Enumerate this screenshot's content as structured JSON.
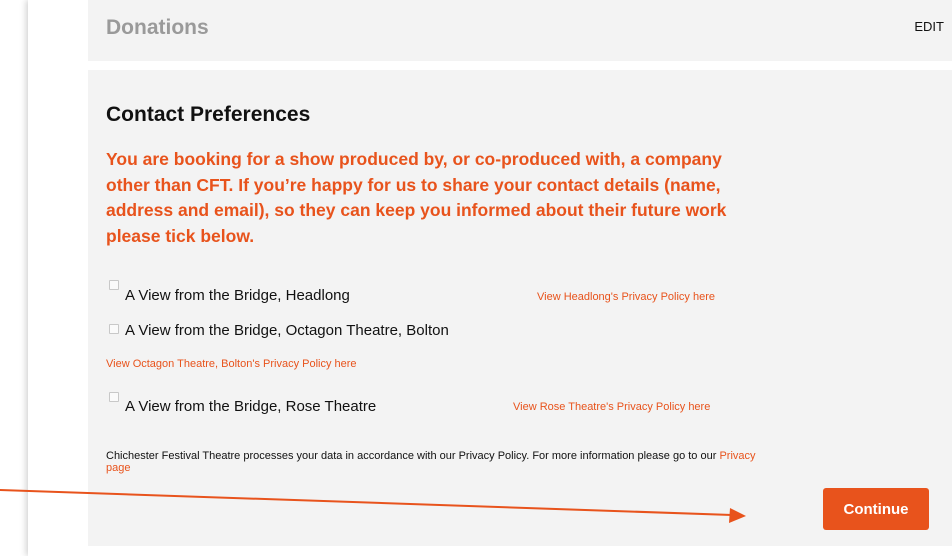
{
  "donations": {
    "title": "Donations",
    "edit_label": "EDIT"
  },
  "contact": {
    "title": "Contact Preferences",
    "notice": "You are booking for a show produced by, or co-produced with, a company other than CFT. If you’re happy for us to share your contact details (name, address and email), so they can keep you informed about their future work please tick below.",
    "options": [
      {
        "label": "A View from the Bridge, Headlong",
        "policy_link": "View Headlong's Privacy Policy here",
        "checked": false
      },
      {
        "label": "A View from the Bridge, Octagon Theatre, Bolton",
        "policy_link": "View Octagon Theatre, Bolton's Privacy Policy here",
        "checked": false
      },
      {
        "label": "A View from the Bridge, Rose Theatre",
        "policy_link": "View Rose Theatre's Privacy Policy here",
        "checked": false
      }
    ],
    "footnote_text": "Chichester Festival Theatre processes your data in accordance with our Privacy Policy. For more information please go to our",
    "footnote_link": "Privacy page",
    "continue_label": "Continue"
  },
  "colors": {
    "accent": "#e8531c",
    "panel_bg": "#f3f3f3",
    "muted_heading": "#9a9a9a"
  }
}
